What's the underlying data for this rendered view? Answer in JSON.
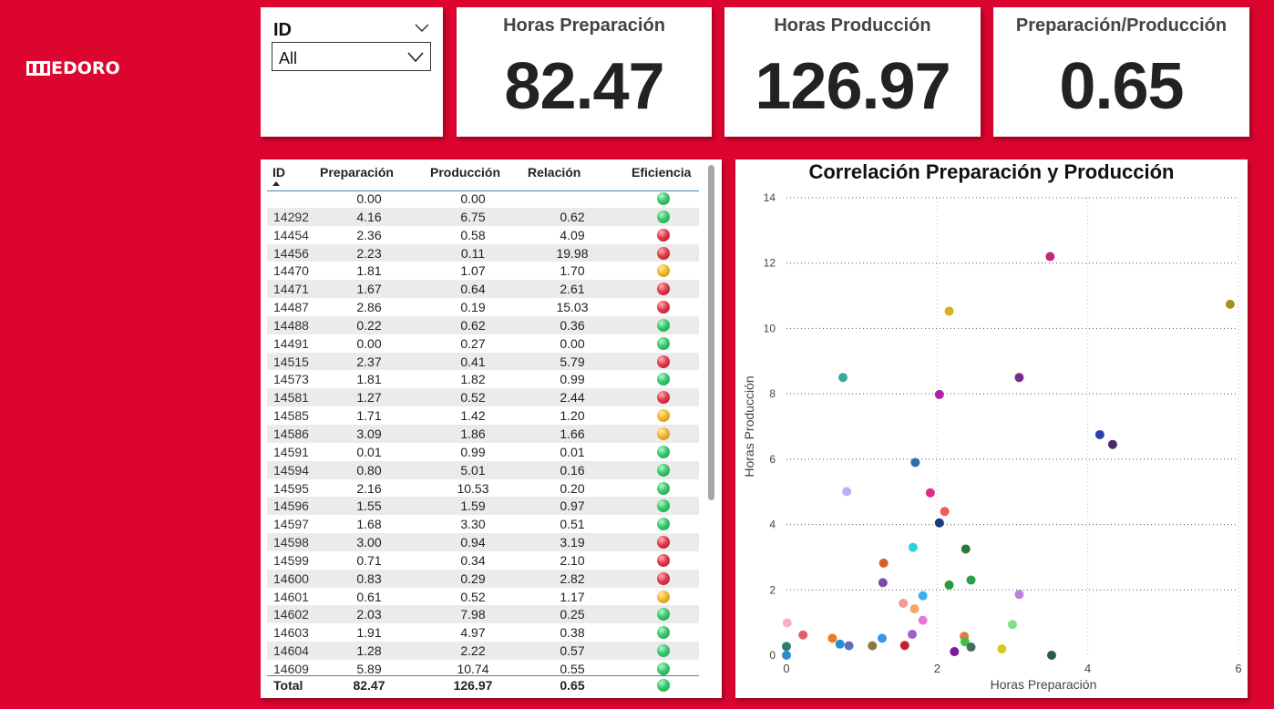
{
  "brand": {
    "logo_text": "EDORO",
    "logo_icon": "medoro-m-logo-icon",
    "background_color": "#dc0530"
  },
  "slicer": {
    "title": "ID",
    "selected": "All"
  },
  "kpis": [
    {
      "title": "Horas Preparación",
      "value": "82.47"
    },
    {
      "title": "Horas Producción",
      "value": "126.97"
    },
    {
      "title": "Preparación/Producción",
      "value": "0.65"
    }
  ],
  "table": {
    "headers": {
      "id": "ID",
      "prep": "Preparación",
      "prod": "Producción",
      "rel": "Relación",
      "eff": "Eficiencia"
    },
    "rows": [
      {
        "id": "",
        "prep": "0.00",
        "prod": "0.00",
        "rel": "",
        "eff": "green"
      },
      {
        "id": "14292",
        "prep": "4.16",
        "prod": "6.75",
        "rel": "0.62",
        "eff": "green"
      },
      {
        "id": "14454",
        "prep": "2.36",
        "prod": "0.58",
        "rel": "4.09",
        "eff": "red"
      },
      {
        "id": "14456",
        "prep": "2.23",
        "prod": "0.11",
        "rel": "19.98",
        "eff": "red"
      },
      {
        "id": "14470",
        "prep": "1.81",
        "prod": "1.07",
        "rel": "1.70",
        "eff": "yellow"
      },
      {
        "id": "14471",
        "prep": "1.67",
        "prod": "0.64",
        "rel": "2.61",
        "eff": "red"
      },
      {
        "id": "14487",
        "prep": "2.86",
        "prod": "0.19",
        "rel": "15.03",
        "eff": "red"
      },
      {
        "id": "14488",
        "prep": "0.22",
        "prod": "0.62",
        "rel": "0.36",
        "eff": "green"
      },
      {
        "id": "14491",
        "prep": "0.00",
        "prod": "0.27",
        "rel": "0.00",
        "eff": "green"
      },
      {
        "id": "14515",
        "prep": "2.37",
        "prod": "0.41",
        "rel": "5.79",
        "eff": "red"
      },
      {
        "id": "14573",
        "prep": "1.81",
        "prod": "1.82",
        "rel": "0.99",
        "eff": "green"
      },
      {
        "id": "14581",
        "prep": "1.27",
        "prod": "0.52",
        "rel": "2.44",
        "eff": "red"
      },
      {
        "id": "14585",
        "prep": "1.71",
        "prod": "1.42",
        "rel": "1.20",
        "eff": "yellow"
      },
      {
        "id": "14586",
        "prep": "3.09",
        "prod": "1.86",
        "rel": "1.66",
        "eff": "yellow"
      },
      {
        "id": "14591",
        "prep": "0.01",
        "prod": "0.99",
        "rel": "0.01",
        "eff": "green"
      },
      {
        "id": "14594",
        "prep": "0.80",
        "prod": "5.01",
        "rel": "0.16",
        "eff": "green"
      },
      {
        "id": "14595",
        "prep": "2.16",
        "prod": "10.53",
        "rel": "0.20",
        "eff": "green"
      },
      {
        "id": "14596",
        "prep": "1.55",
        "prod": "1.59",
        "rel": "0.97",
        "eff": "green"
      },
      {
        "id": "14597",
        "prep": "1.68",
        "prod": "3.30",
        "rel": "0.51",
        "eff": "green"
      },
      {
        "id": "14598",
        "prep": "3.00",
        "prod": "0.94",
        "rel": "3.19",
        "eff": "red"
      },
      {
        "id": "14599",
        "prep": "0.71",
        "prod": "0.34",
        "rel": "2.10",
        "eff": "red"
      },
      {
        "id": "14600",
        "prep": "0.83",
        "prod": "0.29",
        "rel": "2.82",
        "eff": "red"
      },
      {
        "id": "14601",
        "prep": "0.61",
        "prod": "0.52",
        "rel": "1.17",
        "eff": "yellow"
      },
      {
        "id": "14602",
        "prep": "2.03",
        "prod": "7.98",
        "rel": "0.25",
        "eff": "green"
      },
      {
        "id": "14603",
        "prep": "1.91",
        "prod": "4.97",
        "rel": "0.38",
        "eff": "green"
      },
      {
        "id": "14604",
        "prep": "1.28",
        "prod": "2.22",
        "rel": "0.57",
        "eff": "green"
      },
      {
        "id": "14609",
        "prep": "5.89",
        "prod": "10.74",
        "rel": "0.55",
        "eff": "green"
      }
    ],
    "total": {
      "label": "Total",
      "prep": "82.47",
      "prod": "126.97",
      "rel": "0.65",
      "eff": "green"
    }
  },
  "chart_data": {
    "type": "scatter",
    "title": "Correlación Preparación y Producción",
    "xlabel": "Horas Preparación",
    "ylabel": "Horas Producción",
    "xlim": [
      0,
      6
    ],
    "ylim": [
      0,
      14
    ],
    "xticks": [
      0,
      2,
      4,
      6
    ],
    "yticks": [
      0,
      2,
      4,
      6,
      8,
      10,
      12,
      14
    ],
    "grid": true,
    "points": [
      {
        "x": 0.0,
        "y": 0.0,
        "color": "#2b8ad6"
      },
      {
        "x": 0.0,
        "y": 0.27,
        "color": "#2e7d6b"
      },
      {
        "x": 0.01,
        "y": 0.99,
        "color": "#f7b0d0"
      },
      {
        "x": 0.22,
        "y": 0.62,
        "color": "#e0606a"
      },
      {
        "x": 0.61,
        "y": 0.52,
        "color": "#ef7a1a"
      },
      {
        "x": 0.71,
        "y": 0.34,
        "color": "#1f94d4"
      },
      {
        "x": 0.75,
        "y": 8.5,
        "color": "#37a89a"
      },
      {
        "x": 0.8,
        "y": 5.01,
        "color": "#b8b0f5"
      },
      {
        "x": 0.83,
        "y": 0.29,
        "color": "#5a6fbf"
      },
      {
        "x": 1.14,
        "y": 0.29,
        "color": "#8a7a3a"
      },
      {
        "x": 1.27,
        "y": 0.52,
        "color": "#3a95e8"
      },
      {
        "x": 1.28,
        "y": 2.22,
        "color": "#7b4ca8"
      },
      {
        "x": 1.29,
        "y": 2.82,
        "color": "#d2602a"
      },
      {
        "x": 1.55,
        "y": 1.59,
        "color": "#f29a9a"
      },
      {
        "x": 1.57,
        "y": 0.3,
        "color": "#c8202a"
      },
      {
        "x": 1.67,
        "y": 0.64,
        "color": "#a060d0"
      },
      {
        "x": 1.68,
        "y": 3.3,
        "color": "#2ad4d4"
      },
      {
        "x": 1.7,
        "y": 1.42,
        "color": "#f5a56a"
      },
      {
        "x": 1.71,
        "y": 5.9,
        "color": "#2a6fb0"
      },
      {
        "x": 1.81,
        "y": 1.07,
        "color": "#e878d8"
      },
      {
        "x": 1.81,
        "y": 1.82,
        "color": "#3ab0f0"
      },
      {
        "x": 1.91,
        "y": 4.97,
        "color": "#e02a90"
      },
      {
        "x": 2.03,
        "y": 7.98,
        "color": "#b020a8"
      },
      {
        "x": 2.03,
        "y": 4.05,
        "color": "#1a3a7a"
      },
      {
        "x": 2.1,
        "y": 4.4,
        "color": "#f05a5a"
      },
      {
        "x": 2.16,
        "y": 10.53,
        "color": "#d8b020"
      },
      {
        "x": 2.16,
        "y": 2.15,
        "color": "#2a9a3a"
      },
      {
        "x": 2.23,
        "y": 0.11,
        "color": "#7a1a9a"
      },
      {
        "x": 2.36,
        "y": 0.58,
        "color": "#e07a4a"
      },
      {
        "x": 2.37,
        "y": 0.41,
        "color": "#40c040"
      },
      {
        "x": 2.38,
        "y": 3.25,
        "color": "#2a7a3a"
      },
      {
        "x": 2.45,
        "y": 2.3,
        "color": "#2aa04a"
      },
      {
        "x": 2.45,
        "y": 0.25,
        "color": "#4a6a5a"
      },
      {
        "x": 2.86,
        "y": 0.19,
        "color": "#d8c820"
      },
      {
        "x": 3.0,
        "y": 0.94,
        "color": "#80e080"
      },
      {
        "x": 3.09,
        "y": 1.86,
        "color": "#c080e0"
      },
      {
        "x": 3.09,
        "y": 8.5,
        "color": "#7a2a8a"
      },
      {
        "x": 3.5,
        "y": 12.2,
        "color": "#c02a7a"
      },
      {
        "x": 3.52,
        "y": 0.0,
        "color": "#2a5a4a"
      },
      {
        "x": 4.16,
        "y": 6.75,
        "color": "#2a40a8"
      },
      {
        "x": 4.33,
        "y": 6.45,
        "color": "#4a2a6a"
      },
      {
        "x": 5.89,
        "y": 10.74,
        "color": "#a8901a"
      }
    ]
  }
}
